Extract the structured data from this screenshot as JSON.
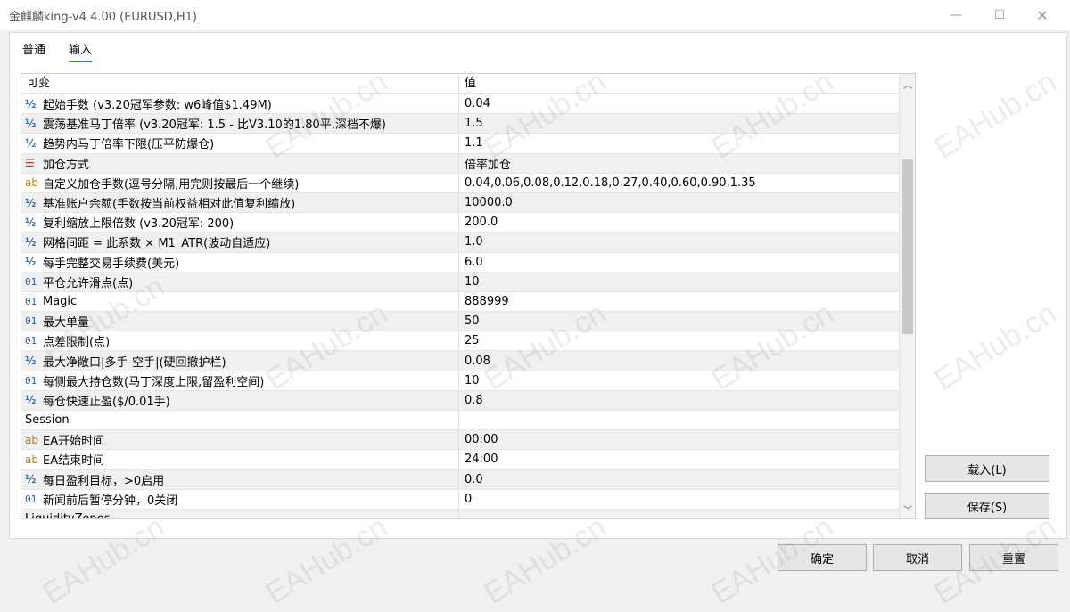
{
  "window": {
    "title": "金麒麟king-v4 4.00 (EURUSD,H1)",
    "minimize": "—",
    "maximize": "☐",
    "close": "✕"
  },
  "tabs": [
    {
      "label": "普通",
      "active": false
    },
    {
      "label": "输入",
      "active": true
    }
  ],
  "grid": {
    "headers": {
      "name": "可变",
      "value": "值"
    },
    "rows": [
      {
        "icon": "half",
        "name": "起始手数 (v3.20冠军参数: w6峰值$1.49M)",
        "value": "0.04"
      },
      {
        "icon": "half",
        "name": "震荡基准马丁倍率 (v3.20冠军: 1.5 - 比V3.10的1.80平,深档不爆)",
        "value": "1.5"
      },
      {
        "icon": "half",
        "name": "趋势内马丁倍率下限(压平防爆仓)",
        "value": "1.1"
      },
      {
        "icon": "enum",
        "name": "加仓方式",
        "value": "倍率加仓"
      },
      {
        "icon": "str",
        "name": "自定义加仓手数(逗号分隔,用完则按最后一个继续)",
        "value": "0.04,0.06,0.08,0.12,0.18,0.27,0.40,0.60,0.90,1.35"
      },
      {
        "icon": "half",
        "name": "基准账户余额(手数按当前权益相对此值复利缩放)",
        "value": "10000.0"
      },
      {
        "icon": "half",
        "name": "复利缩放上限倍数 (v3.20冠军: 200)",
        "value": "200.0"
      },
      {
        "icon": "half",
        "name": "网格间距 = 此系数 × M1_ATR(波动自适应)",
        "value": "1.0"
      },
      {
        "icon": "half",
        "name": "每手完整交易手续费(美元)",
        "value": "6.0"
      },
      {
        "icon": "int",
        "name": "平仓允许滑点(点)",
        "value": "10"
      },
      {
        "icon": "int",
        "name": "Magic",
        "value": "888999"
      },
      {
        "icon": "int",
        "name": "最大单量",
        "value": "50"
      },
      {
        "icon": "int",
        "name": "点差限制(点)",
        "value": "25"
      },
      {
        "icon": "half",
        "name": "最大净敞口|多手-空手|(硬回撤护栏)",
        "value": "0.08"
      },
      {
        "icon": "int",
        "name": "每侧最大持仓数(马丁深度上限,留盈利空间)",
        "value": "10"
      },
      {
        "icon": "half",
        "name": "每仓快速止盈($/0.01手)",
        "value": "0.8"
      },
      {
        "icon": "none",
        "name": "Session",
        "value": ""
      },
      {
        "icon": "str",
        "name": "EA开始时间",
        "value": "00:00"
      },
      {
        "icon": "str",
        "name": "EA结束时间",
        "value": "24:00"
      },
      {
        "icon": "half",
        "name": "每日盈利目标，>0启用",
        "value": "0.0"
      },
      {
        "icon": "int",
        "name": "新闻前后暂停分钟，0关闭",
        "value": "0"
      },
      {
        "icon": "none",
        "name": "LiquidityZones",
        "value": ""
      }
    ]
  },
  "icon_glyphs": {
    "half": "½",
    "int": "01",
    "str": "ab",
    "enum": "☰",
    "none": ""
  },
  "buttons": {
    "load": "载入(L)",
    "save": "保存(S)",
    "ok": "确定",
    "cancel": "取消",
    "reset": "重置"
  },
  "watermark": "EAHub.cn"
}
